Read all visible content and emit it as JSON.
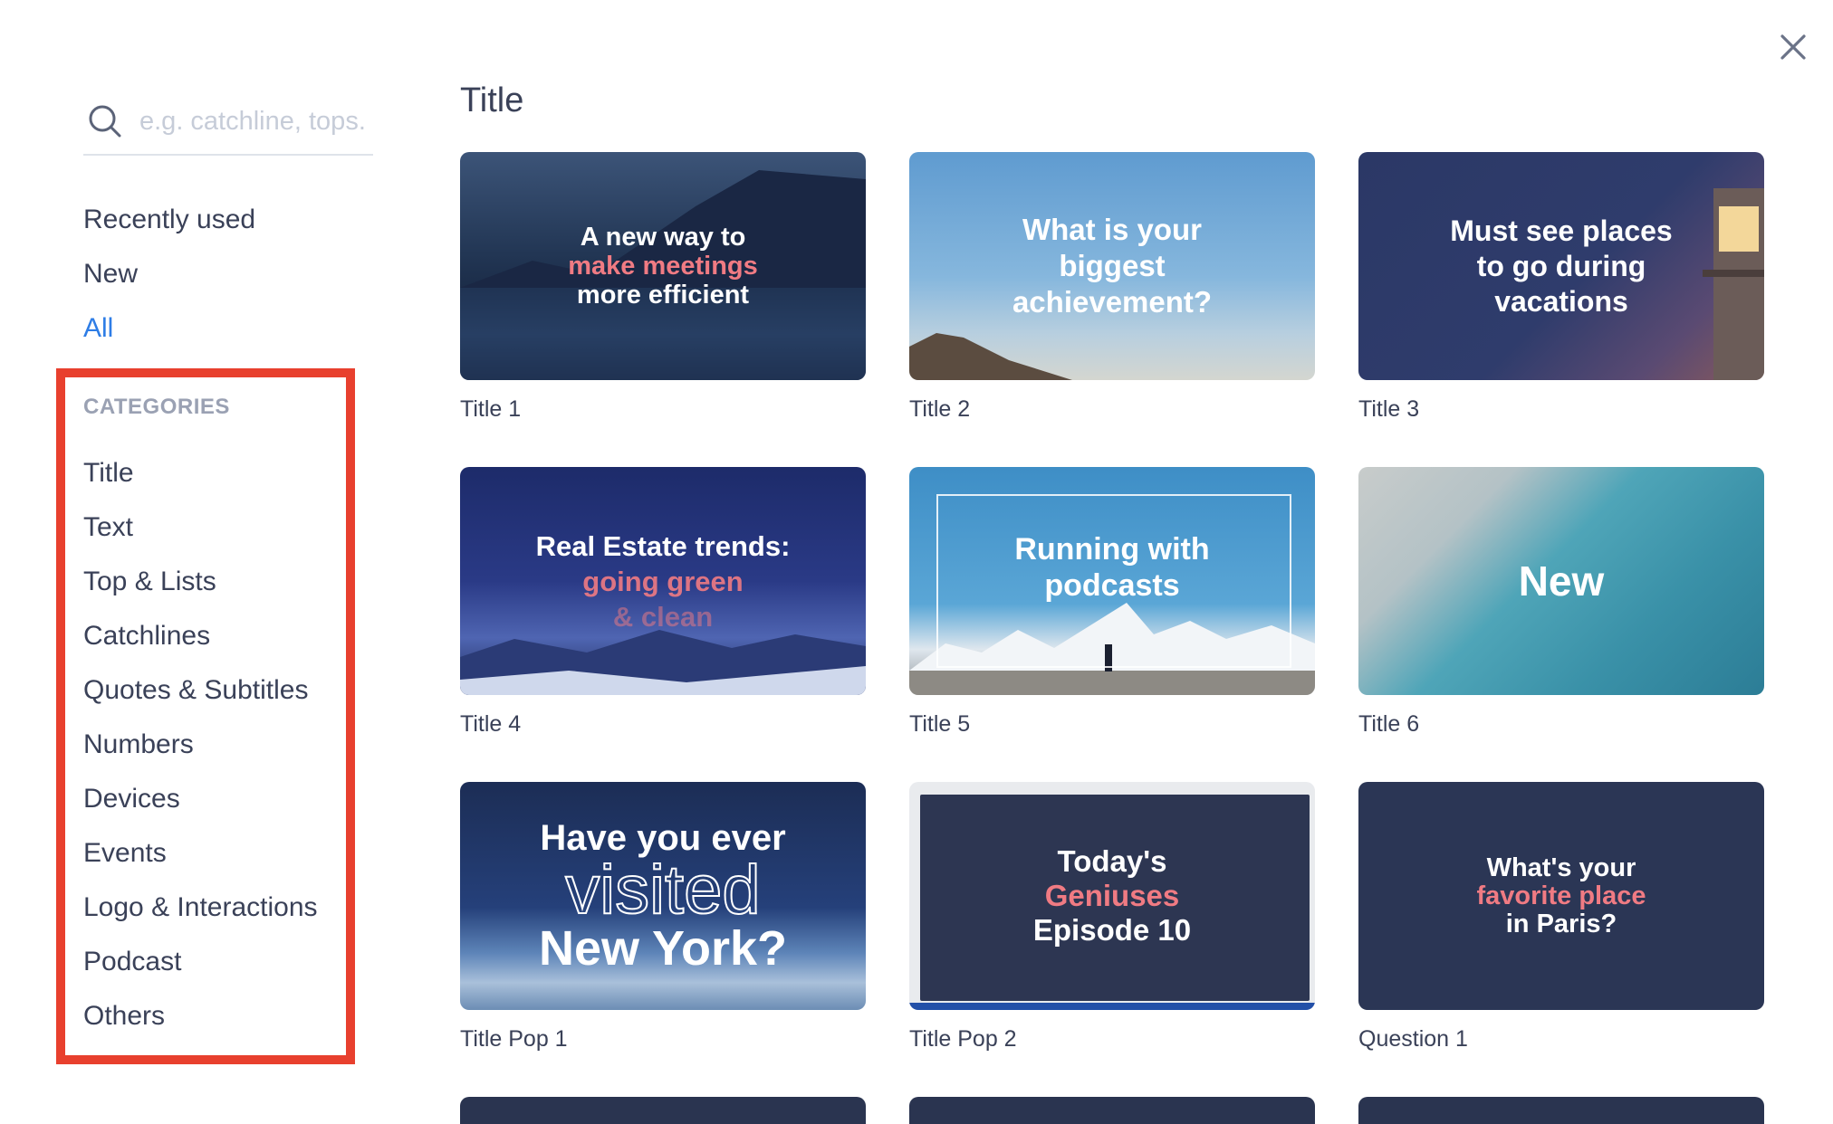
{
  "search": {
    "placeholder": "e.g. catchline, tops."
  },
  "nav": {
    "recently_used": "Recently used",
    "new": "New",
    "all": "All"
  },
  "categories": {
    "header": "CATEGORIES",
    "items": [
      "Title",
      "Text",
      "Top & Lists",
      "Catchlines",
      "Quotes & Subtitles",
      "Numbers",
      "Devices",
      "Events",
      "Logo & Interactions",
      "Podcast",
      "Others"
    ]
  },
  "main": {
    "title": "Title",
    "templates": [
      {
        "label": "Title 1",
        "lines": [
          "A new way to",
          "make meetings",
          "more efficient"
        ]
      },
      {
        "label": "Title 2",
        "lines": [
          "What is your",
          "biggest",
          "achievement?"
        ]
      },
      {
        "label": "Title 3",
        "lines": [
          "Must see places",
          "to go during",
          "vacations"
        ]
      },
      {
        "label": "Title 4",
        "lines": [
          "Real Estate trends:",
          "going green",
          "& clean"
        ]
      },
      {
        "label": "Title 5",
        "lines": [
          "Running with",
          "podcasts"
        ]
      },
      {
        "label": "Title 6",
        "lines": [
          "New"
        ]
      },
      {
        "label": "Title Pop 1",
        "lines": [
          "Have you ever",
          "visited",
          "New York?"
        ]
      },
      {
        "label": "Title Pop 2",
        "lines": [
          "Today's",
          "Geniuses",
          "Episode 10"
        ]
      },
      {
        "label": "Question 1",
        "lines": [
          "What's your",
          "favorite place",
          "in Paris?"
        ]
      }
    ]
  },
  "colors": {
    "accent": "#2e7de6",
    "highlight_box": "#e8402e",
    "text": "#3a4158",
    "pink_text": "#f07b83"
  }
}
